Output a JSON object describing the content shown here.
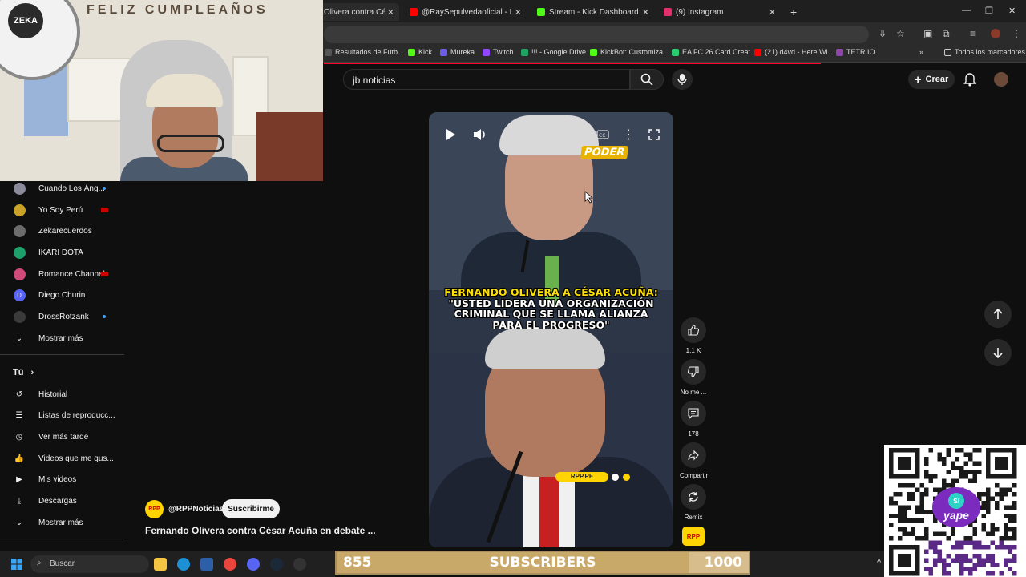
{
  "browser": {
    "tabs": [
      {
        "label": "Olivera contra César",
        "color": "#ff0000"
      },
      {
        "label": "@RaySepulvedaoficial - No Vali",
        "color": "#ff0000"
      },
      {
        "label": "Stream - Kick Dashboard",
        "color": "#53fc18"
      },
      {
        "label": "(9) Instagram",
        "color": "#e1306c"
      }
    ],
    "new_tab": "+",
    "bookmarks": [
      {
        "label": "Resultados de Fútb...",
        "color": "#555555"
      },
      {
        "label": "Kick",
        "color": "#53fc18"
      },
      {
        "label": "Mureka",
        "color": "#6c5ce7"
      },
      {
        "label": "Twitch",
        "color": "#9146ff"
      },
      {
        "label": "!!! - Google Drive",
        "color": "#1fa463"
      },
      {
        "label": "KickBot: Customiza...",
        "color": "#53fc18"
      },
      {
        "label": "EA FC 26 Card Creat...",
        "color": "#2ecc71"
      },
      {
        "label": "(21) d4vd - Here Wi...",
        "color": "#ff0000"
      },
      {
        "label": "TETR.IO",
        "color": "#8e44ad"
      }
    ],
    "all_bookmarks": "Todos los marcadores"
  },
  "youtube": {
    "search_value": "jb noticias",
    "create_label": "Crear"
  },
  "sidebar": {
    "subscriptions": [
      {
        "label": "Cuando Los Áng...",
        "badge": "dot",
        "color": "#8a8a9a"
      },
      {
        "label": "Yo Soy Perú",
        "badge": "live",
        "color": "#c9a227"
      },
      {
        "label": "Zekarecuerdos",
        "badge": "",
        "color": "#6c6c6c"
      },
      {
        "label": "IKARI DOTA",
        "badge": "",
        "color": "#1e9e6a"
      },
      {
        "label": "Romance Channel",
        "badge": "live",
        "color": "#d04a7a"
      },
      {
        "label": "Diego Churin",
        "badge": "",
        "color": "#5865f2"
      },
      {
        "label": "DrossRotzank",
        "badge": "dot",
        "color": "#3a3a3a"
      }
    ],
    "show_more_1": "Mostrar más",
    "you_title": "Tú",
    "you_items": [
      {
        "label": "Historial",
        "icon": "history-icon"
      },
      {
        "label": "Listas de reproducc...",
        "icon": "playlist-icon"
      },
      {
        "label": "Ver más tarde",
        "icon": "clock-icon"
      },
      {
        "label": "Videos que me gus...",
        "icon": "like-icon"
      },
      {
        "label": "Mis videos",
        "icon": "my-videos-icon"
      },
      {
        "label": "Descargas",
        "icon": "download-icon"
      }
    ],
    "show_more_2": "Mostrar más"
  },
  "short": {
    "channel_tag": "PODER",
    "caption_line1": "FERNANDO OLIVERA A CÉSAR ACUÑA:",
    "caption_line2": "\"USTED LIDERA UNA ORGANIZACIÓN",
    "caption_line3": "CRIMINAL QUE SE LLAMA ALIANZA",
    "caption_line4": "PARA EL PROGRESO\"",
    "watermark": "RPP.PE",
    "channel_handle": "@RPPNoticias",
    "subscribe_label": "Suscribirme",
    "title": "Fernando Olivera contra César Acuña en debate ...",
    "channel_logo": "RPP"
  },
  "actions": {
    "likes": "1,1 K",
    "dislike": "No me ...",
    "comments": "178",
    "share": "Compartir",
    "remix": "Remix"
  },
  "webcam": {
    "banner": "FELIZ CUMPLEAÑOS",
    "logo": "ZEKA"
  },
  "subbar": {
    "current": "855",
    "label": "SUBSCRIBERS",
    "goal": "1000",
    "progress": 0.855
  },
  "qr": {
    "brand": "yape",
    "coin": "S/"
  },
  "taskbar": {
    "search_placeholder": "Buscar"
  }
}
